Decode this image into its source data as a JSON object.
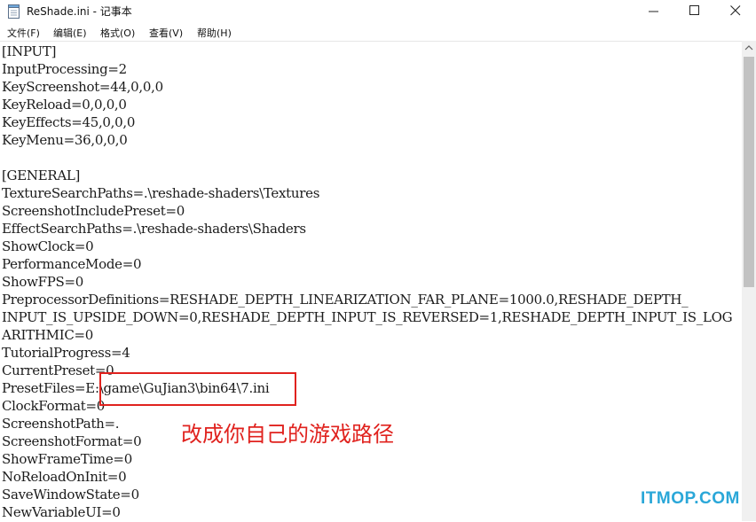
{
  "window": {
    "title": "ReShade.ini - 记事本",
    "icon": "notepad-icon",
    "controls": [
      "minimize-icon",
      "maximize-icon",
      "close-icon"
    ]
  },
  "menu": {
    "items": [
      {
        "label": "文件(F)"
      },
      {
        "label": "编辑(E)"
      },
      {
        "label": "格式(O)"
      },
      {
        "label": "查看(V)"
      },
      {
        "label": "帮助(H)"
      }
    ]
  },
  "editor": {
    "lines": [
      "[INPUT]",
      "InputProcessing=2",
      "KeyScreenshot=44,0,0,0",
      "KeyReload=0,0,0,0",
      "KeyEffects=45,0,0,0",
      "KeyMenu=36,0,0,0",
      "",
      "[GENERAL]",
      "TextureSearchPaths=.\\reshade-shaders\\Textures",
      "ScreenshotIncludePreset=0",
      "EffectSearchPaths=.\\reshade-shaders\\Shaders",
      "ShowClock=0",
      "PerformanceMode=0",
      "ShowFPS=0",
      "PreprocessorDefinitions=RESHADE_DEPTH_LINEARIZATION_FAR_PLANE=1000.0,RESHADE_DEPTH_",
      "INPUT_IS_UPSIDE_DOWN=0,RESHADE_DEPTH_INPUT_IS_REVERSED=1,RESHADE_DEPTH_INPUT_IS_LOG",
      "ARITHMIC=0",
      "TutorialProgress=4",
      "CurrentPreset=0",
      "PresetFiles=E:\\game\\GuJian3\\bin64\\7.ini",
      "ClockFormat=0",
      "ScreenshotPath=.",
      "ScreenshotFormat=0",
      "ShowFrameTime=0",
      "NoReloadOnInit=0",
      "SaveWindowState=0",
      "NewVariableUI=0"
    ]
  },
  "annotation": {
    "text": "改成你自己的游戏路径",
    "color": "#e0221e"
  },
  "watermark": {
    "text": "ITMOP.COM",
    "color": "#2aa7d8"
  }
}
